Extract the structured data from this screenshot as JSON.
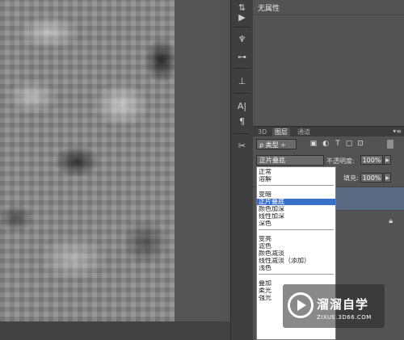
{
  "properties_panel": {
    "title": "无属性"
  },
  "layers_panel": {
    "tabs": [
      {
        "label": "3D",
        "active": false
      },
      {
        "label": "图层",
        "active": true
      },
      {
        "label": "通道",
        "active": false
      }
    ],
    "menu_glyph": "▾≡",
    "kind_filter": "ρ 类型 ÷",
    "blend_mode": "正片叠底",
    "opacity_label": "不透明度:",
    "opacity_value": "100%",
    "fill_label": "填充:",
    "fill_value": "100%",
    "selected_layer_color": "#5a6a83"
  },
  "blend_menu": {
    "selected": "正片叠底",
    "groups": [
      [
        "正常",
        "溶解"
      ],
      [
        "变暗",
        "正片叠底",
        "颜色加深",
        "线性加深",
        "深色"
      ],
      [
        "变亮",
        "滤色",
        "颜色减淡",
        "线性减淡（添加）",
        "浅色"
      ],
      [
        "叠加",
        "柔光",
        "强光"
      ]
    ],
    "selected_color": "#3a6fc9"
  },
  "toolstrip": {
    "icons": [
      "move-icon",
      "play-icon",
      "brush-presets-icon",
      "tool-presets-icon",
      "clone-source-icon",
      "character-icon",
      "paragraph-icon",
      "tools-icon"
    ]
  },
  "watermark": {
    "title": "溜溜自学",
    "subtitle": "ZIXUE.3D66.COM"
  }
}
